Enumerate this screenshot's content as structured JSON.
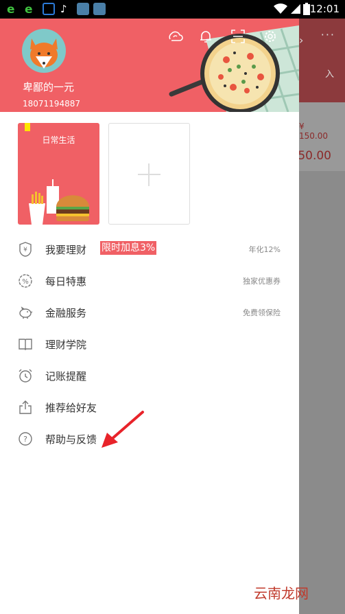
{
  "status_bar": {
    "time": "12:01",
    "icons": [
      "browser-e-icon",
      "browser-e-icon",
      "bag-icon",
      "tiktok-icon",
      "app-icon",
      "app-icon",
      "wifi-icon",
      "signal-icon",
      "battery-icon"
    ]
  },
  "drawer": {
    "header": {
      "username": "卑鄙的一元",
      "phone": "18071194887",
      "icons": [
        "sync-icon",
        "bell-icon",
        "scan-icon",
        "settings-icon"
      ]
    },
    "cards": {
      "first_label": "日常生活",
      "add_icon": "plus-icon"
    },
    "menu": [
      {
        "label": "我要理财",
        "badge": "限时加息3%",
        "right": "年化12%",
        "icon": "shield-yen-icon"
      },
      {
        "label": "每日特惠",
        "right": "独家优惠券",
        "icon": "discount-icon"
      },
      {
        "label": "金融服务",
        "right": "免费领保险",
        "icon": "piggy-bank-icon"
      },
      {
        "label": "理财学院",
        "icon": "book-icon"
      },
      {
        "label": "记账提醒",
        "icon": "alarm-clock-icon"
      },
      {
        "label": "推荐给好友",
        "icon": "share-icon"
      },
      {
        "label": "帮助与反馈",
        "icon": "help-icon"
      }
    ]
  },
  "background": {
    "label_partial": "入",
    "amount_small": "¥ 150.00",
    "amount_large": "50.00"
  },
  "watermark": "云南龙网",
  "colors": {
    "accent": "#f06065",
    "annotation_arrow": "#e8232a"
  }
}
